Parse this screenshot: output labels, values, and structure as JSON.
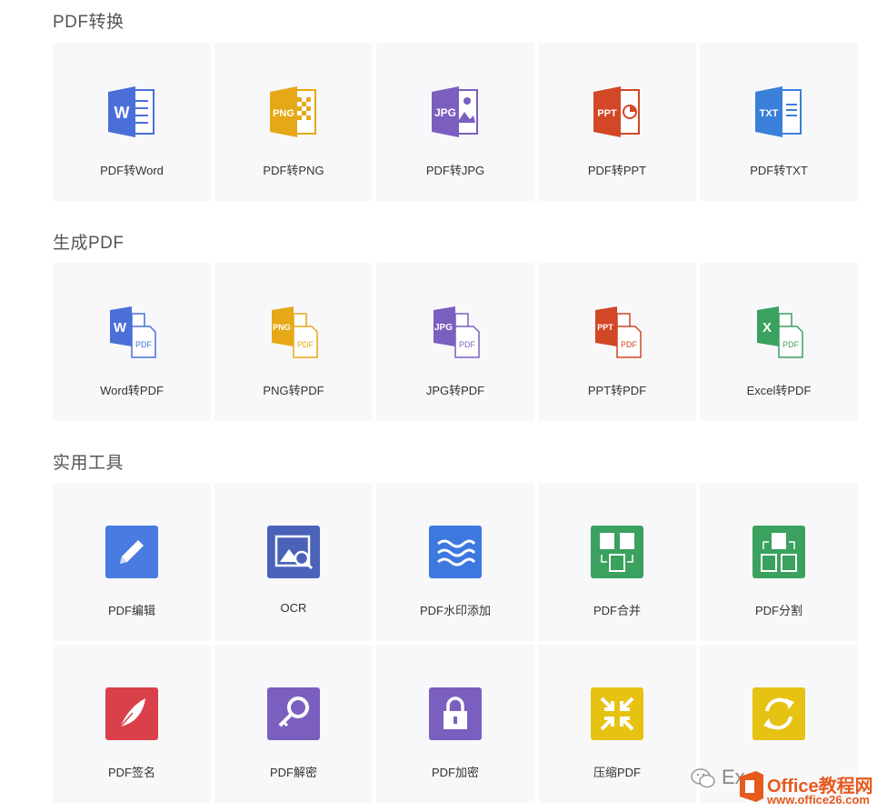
{
  "sections": [
    {
      "title": "PDF转换"
    },
    {
      "title": "生成PDF"
    },
    {
      "title": "实用工具"
    }
  ],
  "pdf_convert": [
    {
      "label": "PDF转Word",
      "icon": "word-doc-icon",
      "color": "#4a6fd8"
    },
    {
      "label": "PDF转PNG",
      "icon": "png-doc-icon",
      "color": "#e6a817"
    },
    {
      "label": "PDF转JPG",
      "icon": "jpg-doc-icon",
      "color": "#7b5fbf"
    },
    {
      "label": "PDF转PPT",
      "icon": "ppt-doc-icon",
      "color": "#d24726"
    },
    {
      "label": "PDF转TXT",
      "icon": "txt-doc-icon",
      "color": "#3a7fd8"
    }
  ],
  "make_pdf": [
    {
      "label": "Word转PDF",
      "icon": "word-to-pdf-icon",
      "color": "#4a6fd8"
    },
    {
      "label": "PNG转PDF",
      "icon": "png-to-pdf-icon",
      "color": "#e6a817"
    },
    {
      "label": "JPG转PDF",
      "icon": "jpg-to-pdf-icon",
      "color": "#7b5fbf"
    },
    {
      "label": "PPT转PDF",
      "icon": "ppt-to-pdf-icon",
      "color": "#d24726"
    },
    {
      "label": "Excel转PDF",
      "icon": "excel-to-pdf-icon",
      "color": "#3aa15f"
    }
  ],
  "tools_row1": [
    {
      "label": "PDF编辑",
      "icon": "pencil-icon",
      "color": "#4a7be0"
    },
    {
      "label": "OCR",
      "icon": "image-search-icon",
      "color": "#4a62b8"
    },
    {
      "label": "PDF水印添加",
      "icon": "waves-icon",
      "color": "#3d78e0"
    },
    {
      "label": "PDF合并",
      "icon": "merge-icon",
      "color": "#3aa15f"
    },
    {
      "label": "PDF分割",
      "icon": "split-icon",
      "color": "#3aa15f"
    }
  ],
  "tools_row2": [
    {
      "label": "PDF签名",
      "icon": "feather-icon",
      "color": "#d9404a"
    },
    {
      "label": "PDF解密",
      "icon": "key-icon",
      "color": "#7b5fbf"
    },
    {
      "label": "PDF加密",
      "icon": "lock-icon",
      "color": "#7b5fbf"
    },
    {
      "label": "压缩PDF",
      "icon": "compress-icon",
      "color": "#e6c213"
    },
    {
      "label": "",
      "icon": "sync-icon",
      "color": "#e6c213"
    }
  ],
  "icon_text": {
    "word": "W",
    "png": "PNG",
    "jpg": "JPG",
    "ppt": "PPT",
    "txt": "TXT",
    "excel": "X",
    "pdf": "PDF"
  },
  "watermark": {
    "text": "Ex",
    "brand": "Office教程网",
    "url": "www.office26.com"
  }
}
